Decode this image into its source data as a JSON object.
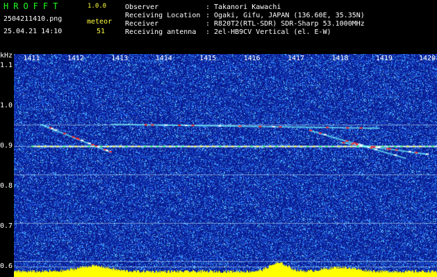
{
  "brand": {
    "name": "HROFFT",
    "version": "1.0.0"
  },
  "file": {
    "name": "2504211410.png",
    "datetime": "25.04.21 14:10"
  },
  "mode": {
    "label": "meteor",
    "count": "51"
  },
  "info": [
    {
      "key": "Observer",
      "value": ": Takanori Kawachi"
    },
    {
      "key": "Receiving Location",
      "value": ": Ogaki, Gifu, JAPAN (136.60E, 35.35N)"
    },
    {
      "key": "Receiver",
      "value": ": R820T2(RTL-SDR) SDR-Sharp 53.1000MHz"
    },
    {
      "key": "Receiving antenna",
      "value": ": 2el-HB9CV Vertical (el. E-W)"
    }
  ],
  "chart_data": {
    "type": "heatmap",
    "ylabel": "kHz",
    "x_ticks": [
      "1411",
      "1412",
      "1413",
      "1414",
      "1415",
      "1416",
      "1417",
      "1418",
      "1419",
      "1420"
    ],
    "y_ticks": [
      "1.1",
      "1.0",
      "0.9",
      "0.8",
      "0.7",
      "0.6"
    ],
    "x_range": [
      1410.6,
      1420.2
    ],
    "y_range": [
      0.575,
      1.13
    ],
    "horizontal_lines_khz": [
      0.955,
      0.9,
      0.83,
      0.71,
      0.615,
      0.6
    ],
    "strong_line_khz": 0.9,
    "meteor_traces": [
      {
        "x_start": 1411.2,
        "x_end": 1412.8,
        "y_start": 0.955,
        "y_end": 0.885
      },
      {
        "x_start": 1412.8,
        "x_end": 1418.9,
        "y_start": 0.955,
        "y_end": 0.945
      },
      {
        "x_start": 1417.3,
        "x_end": 1419.5,
        "y_start": 0.94,
        "y_end": 0.87
      },
      {
        "x_start": 1418.0,
        "x_end": 1420.0,
        "y_start": 0.91,
        "y_end": 0.88
      }
    ],
    "colors": {
      "background": "#0a1a8c",
      "noise": "#3aa8ff",
      "line": "#dfffff",
      "peak": "#ffff00",
      "trace": "#ff2a2a"
    }
  }
}
